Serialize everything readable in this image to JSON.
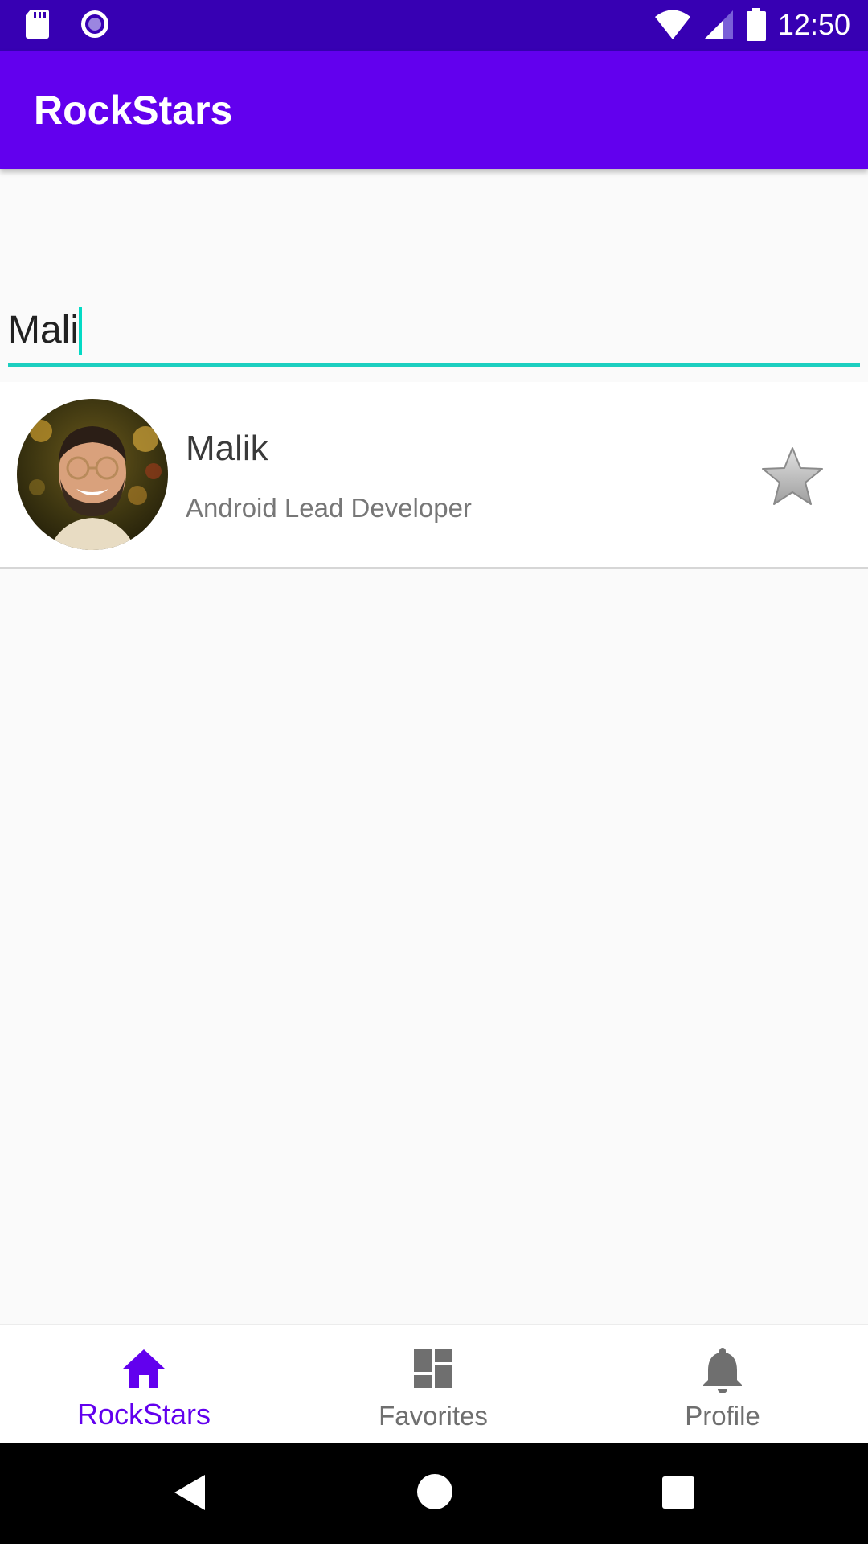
{
  "status_bar": {
    "time": "12:50",
    "icons": [
      "sd-card-icon",
      "record-icon",
      "wifi-icon",
      "signal-icon",
      "battery-icon"
    ],
    "background": "#3700b3"
  },
  "app_bar": {
    "title": "RockStars",
    "background": "#6200ee"
  },
  "search": {
    "value": "Mali",
    "placeholder": "",
    "accent": "#03dac5"
  },
  "results": [
    {
      "name": "Malik",
      "role": "Android Lead Developer",
      "avatar": "avatar-photo",
      "favorite": false
    }
  ],
  "bottom_nav": {
    "items": [
      {
        "label": "RockStars",
        "icon": "home-icon",
        "active": true
      },
      {
        "label": "Favorites",
        "icon": "dashboard-icon",
        "active": false
      },
      {
        "label": "Profile",
        "icon": "bell-icon",
        "active": false
      }
    ],
    "active_color": "#6200ee",
    "inactive_color": "#6f6f6f"
  },
  "system_nav": {
    "buttons": [
      "back-icon",
      "home-circle-icon",
      "recents-icon"
    ]
  }
}
